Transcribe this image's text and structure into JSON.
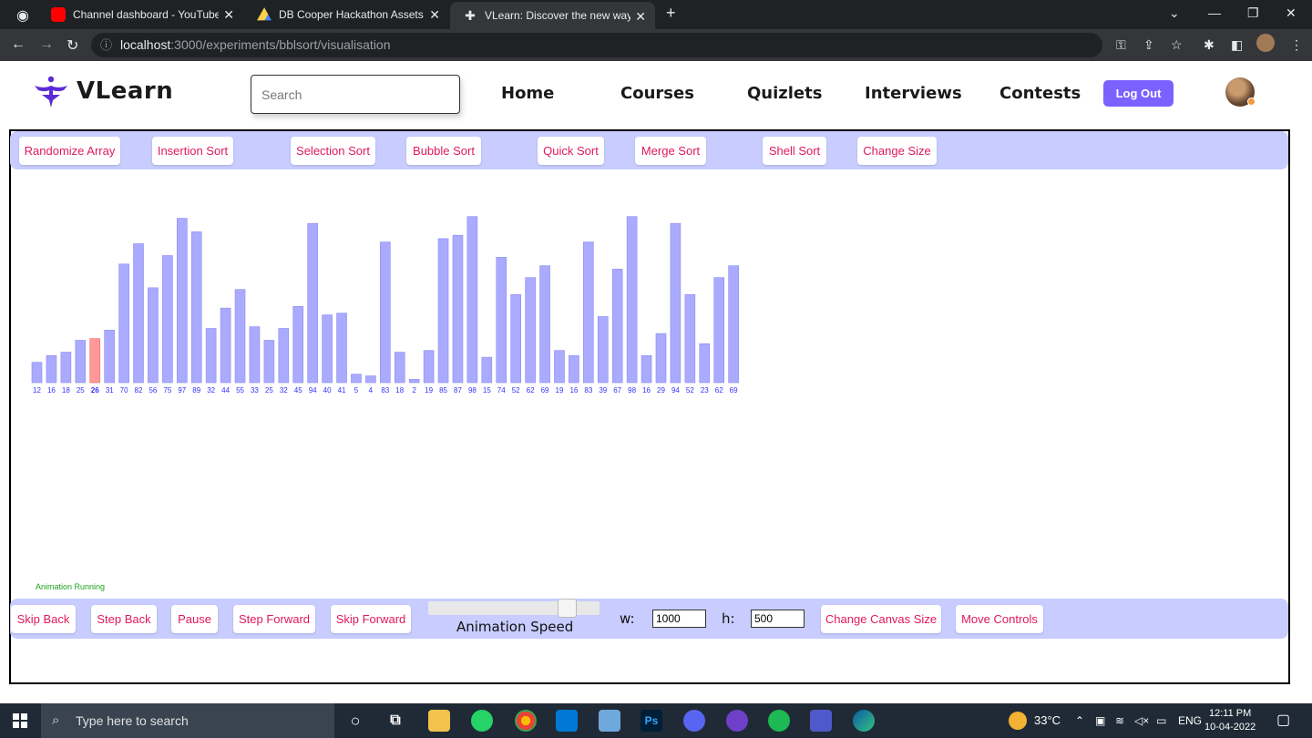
{
  "browser": {
    "tabs": [
      {
        "title": "Channel dashboard - YouTube St",
        "icon": "youtube-icon"
      },
      {
        "title": "DB Cooper Hackathon Assets - G",
        "icon": "google-drive-icon"
      },
      {
        "title": "VLearn: Discover the new way of",
        "icon": "vlearn-icon"
      }
    ],
    "url_host": "localhost",
    "url_path": ":3000/experiments/bblsort/visualisation"
  },
  "header": {
    "logo_text": "VLearn",
    "search_placeholder": "Search",
    "nav": [
      "Home",
      "Courses",
      "Quizlets",
      "Interviews",
      "Contests"
    ],
    "logout_label": "Log Out"
  },
  "toolbar": {
    "buttons": [
      "Randomize Array",
      "Insertion Sort",
      "Selection Sort",
      "Bubble Sort",
      "Quick Sort",
      "Merge Sort",
      "Shell Sort",
      "Change Size"
    ]
  },
  "chart_data": {
    "type": "bar",
    "values": [
      12,
      16,
      18,
      25,
      26,
      31,
      70,
      82,
      56,
      75,
      97,
      89,
      32,
      44,
      55,
      33,
      25,
      32,
      45,
      94,
      40,
      41,
      5,
      4,
      83,
      18,
      2,
      19,
      85,
      87,
      98,
      15,
      74,
      52,
      62,
      69,
      19,
      16,
      83,
      39,
      67,
      98,
      16,
      29,
      94,
      52,
      23,
      62,
      69
    ],
    "highlight_index": 4,
    "bar_color": "#aaaaff",
    "highlight_color": "#ff9999",
    "label_color": "#3333ff",
    "ylim": [
      0,
      100
    ]
  },
  "status_text": "Animation Running",
  "controls": {
    "buttons_left": [
      "Skip Back",
      "Step Back",
      "Pause",
      "Step Forward",
      "Skip Forward"
    ],
    "speed_label": "Animation Speed",
    "speed_fraction": 0.85,
    "w_label": "w:",
    "w_value": "1000",
    "h_label": "h:",
    "h_value": "500",
    "buttons_right": [
      "Change Canvas Size",
      "Move Controls"
    ]
  },
  "taskbar": {
    "search_placeholder": "Type here to search",
    "temperature": "33°C",
    "language": "ENG",
    "time": "12:11 PM",
    "date": "10-04-2022"
  }
}
